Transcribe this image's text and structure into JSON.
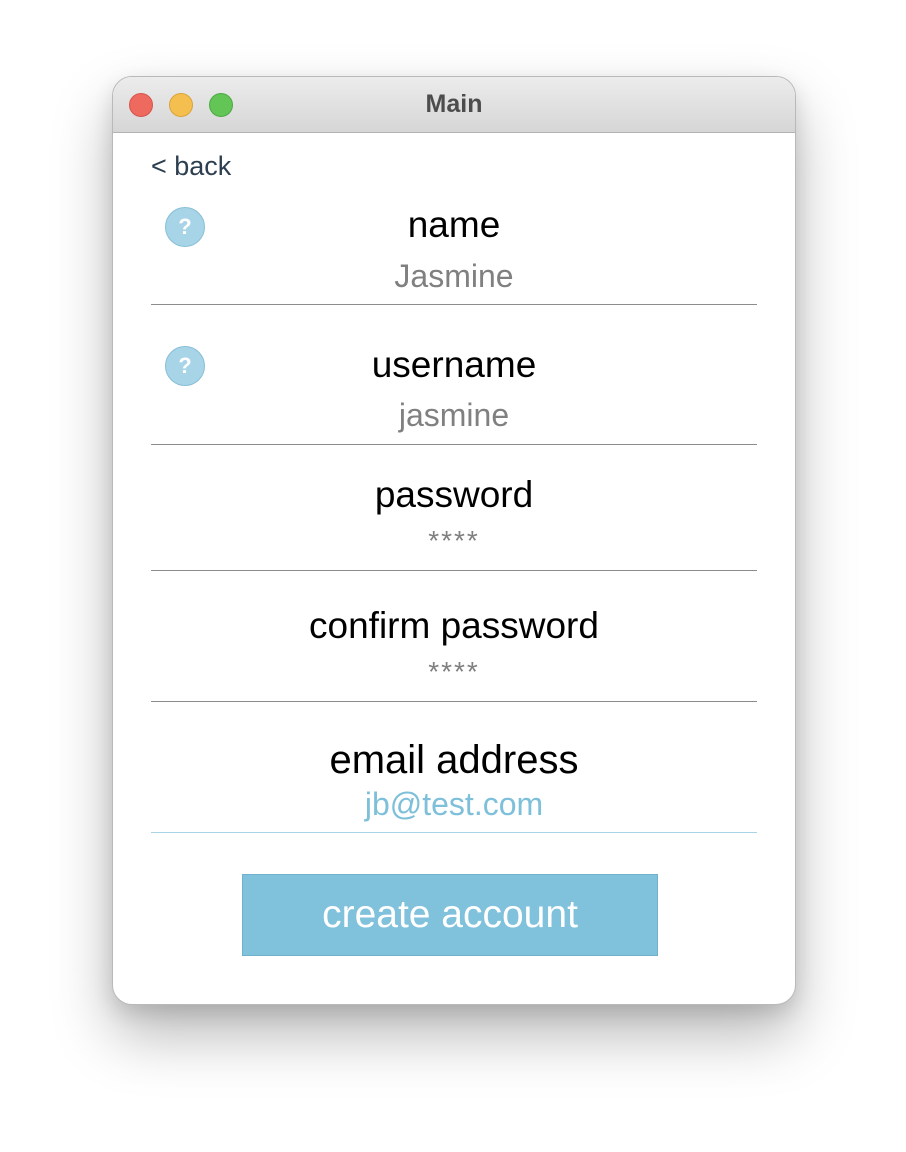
{
  "window": {
    "title": "Main"
  },
  "nav": {
    "back_label": "< back"
  },
  "form": {
    "name": {
      "label": "name",
      "value": "Jasmine",
      "help_icon": "?"
    },
    "username": {
      "label": "username",
      "value": "jasmine",
      "help_icon": "?"
    },
    "password": {
      "label": "password",
      "value": "****"
    },
    "confirm_password": {
      "label": "confirm password",
      "value": "****"
    },
    "email": {
      "label": "email address",
      "value": "jb@test.com"
    },
    "submit_label": "create account"
  },
  "colors": {
    "accent": "#80c1dc",
    "help_icon": "#a8d4e8",
    "close": "#ee6a5f",
    "minimize": "#f5bf4f",
    "zoom": "#62c555"
  },
  "icons": {
    "help": "question-circle-icon"
  }
}
